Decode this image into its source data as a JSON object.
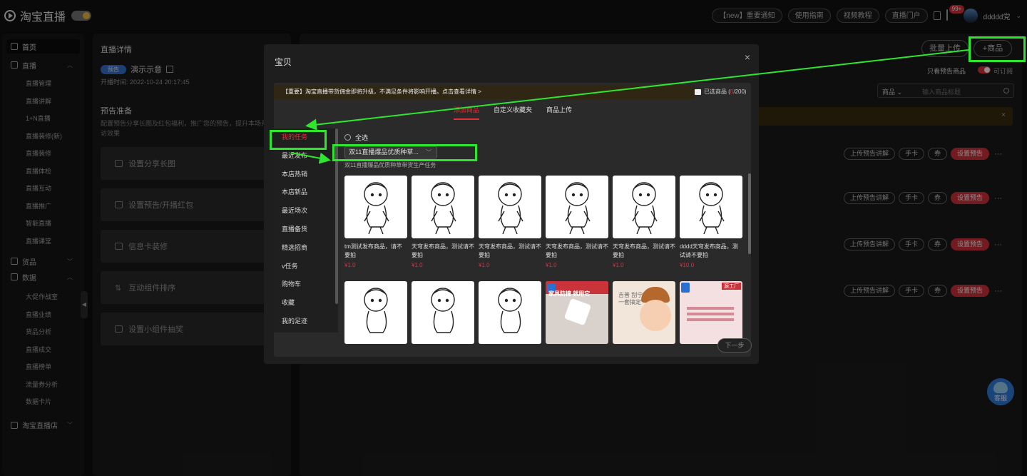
{
  "app": {
    "name": "淘宝直播"
  },
  "topbar": {
    "buttons": [
      "【new】重要通知",
      "使用指南",
      "视频教程",
      "直播门户"
    ],
    "badge": "99+",
    "username": "ddddd党"
  },
  "sidebar": {
    "home": "首页",
    "live_group": "直播",
    "live_items": [
      "直播管理",
      "直播讲解",
      "1+N直播",
      "直播装修(新)",
      "直播装修",
      "直播体检",
      "直播互动",
      "直播推广",
      "智能直播",
      "直播课堂"
    ],
    "goods_group": "货品",
    "data_group": "数据",
    "data_items": [
      "大促作战室",
      "直播业绩",
      "货品分析",
      "直播成交",
      "直播榜单",
      "流量券分析",
      "数据卡片"
    ],
    "store_group": "淘宝直播店"
  },
  "middle": {
    "title": "直播详情",
    "tag": "预告",
    "name": "演示示意",
    "time": "开播时间: 2022-10-24 20:17:45",
    "section_title": "预告准备",
    "section_desc": "配置预告分享长图及红包福利，推广您的预告，提升本场开播回访效果",
    "cards": [
      "设置分享长图",
      "设置预告/开播红包",
      "信息卡装修",
      "互动组件排序",
      "设置小组件抽奖"
    ]
  },
  "right": {
    "batch_upload": "批量上传",
    "add_goods": "+商品",
    "only_preview": "只看预告商品",
    "subscribe": "可订阅",
    "search_select": "商品",
    "search_placeholder": "输入商品标题",
    "row_actions": {
      "upload": "上传预告讲解",
      "card": "手卡",
      "coupon": "券",
      "set": "设置预告",
      "more": "···"
    }
  },
  "modal": {
    "title": "宝贝",
    "close": "×",
    "warning": "【重要】淘宝直播带货佣金即将升级，不满足条件将影响开播。点击查看详情 >",
    "selected_label": "已选商品 (",
    "selected_num": "0",
    "selected_total": "/200)",
    "tabs": [
      "添加商品",
      "自定义收藏夹",
      "商品上传"
    ],
    "menu": [
      "我的任务",
      "最近发布",
      "本店热销",
      "本店新品",
      "最近场次",
      "直播备货",
      "精选招商",
      "v任务",
      "购物车",
      "收藏",
      "我的足迹"
    ],
    "select_all": "全选",
    "task_select": "双11直播爆品优质种草...",
    "task_sub": "双11直播爆品优质种草带货生产任务",
    "products": [
      {
        "name": "tm测试发布商品，请不要拍",
        "price": "¥1.0"
      },
      {
        "name": "天穹发布商品，测试请不要拍",
        "price": "¥1.0"
      },
      {
        "name": "天穹发布商品，测试请不要拍",
        "price": "¥1.0"
      },
      {
        "name": "天穹发布商品，测试请不要拍",
        "price": "¥1.0"
      },
      {
        "name": "天穹发布商品，测试请不要拍",
        "price": "¥1.0"
      },
      {
        "name": "dddd天穹发布商品，测试请不要拍",
        "price": "¥10.0"
      }
    ],
    "row2_texts": {
      "tag1": "家具防撞 就用它",
      "tag2": "吉普 刮宁",
      "tag3": "一套搞定",
      "shop": "源工厂"
    },
    "next": "下一步"
  },
  "service": {
    "label": "客服"
  },
  "annotation_color": "#2ee62e"
}
